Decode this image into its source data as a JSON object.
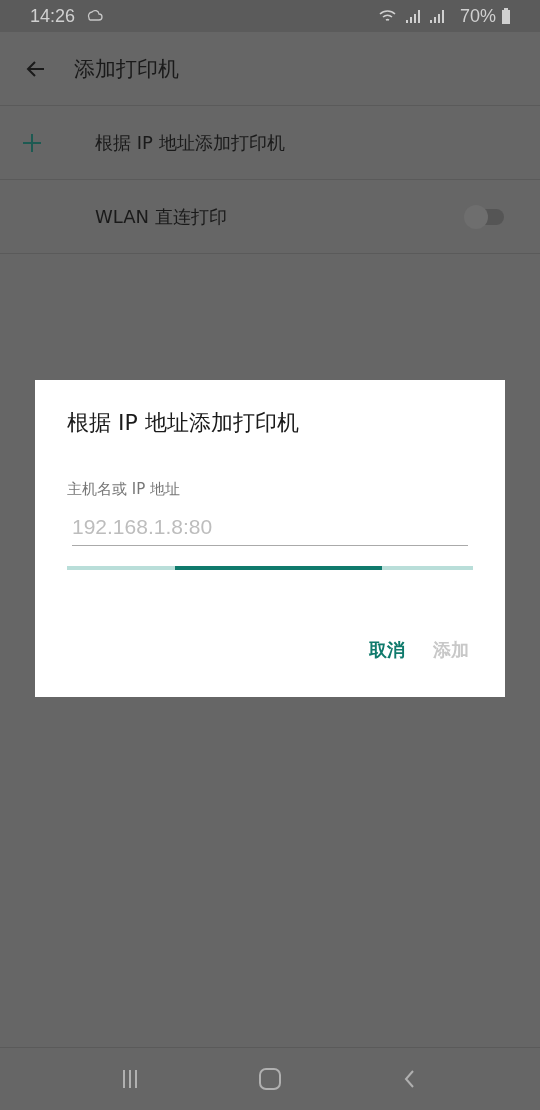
{
  "status_bar": {
    "time": "14:26",
    "battery": "70%"
  },
  "toolbar": {
    "title": "添加打印机"
  },
  "items": [
    {
      "kind": "add",
      "label": "根据 IP 地址添加打印机"
    },
    {
      "kind": "switch",
      "label": "WLAN 直连打印",
      "on": false
    }
  ],
  "dialog": {
    "title": "根据 IP 地址添加打印机",
    "field_label": "主机名或 IP 地址",
    "placeholder": "192.168.1.8:80",
    "progress": {
      "indeterminate": true
    },
    "buttons": [
      {
        "label": "取消",
        "disabled": false
      },
      {
        "label": "添加",
        "disabled": true
      }
    ]
  }
}
